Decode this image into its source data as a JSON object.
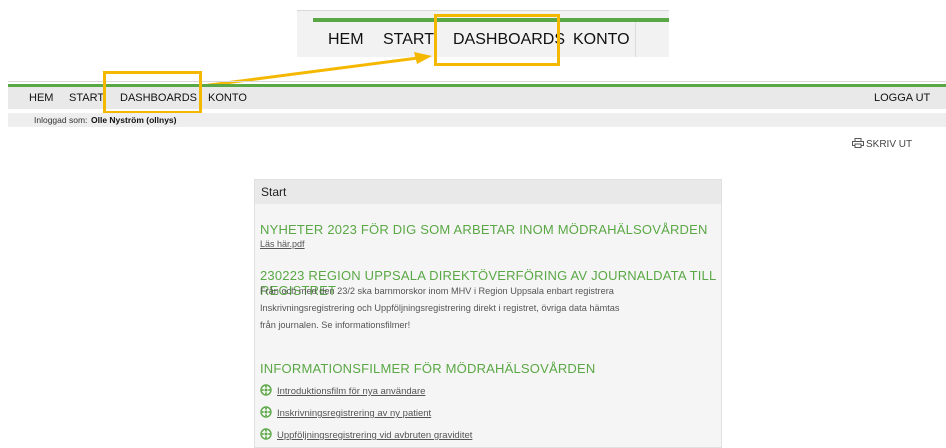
{
  "zoomed_nav": {
    "items": [
      "HEM",
      "START",
      "DASHBOARDS",
      "KONTO"
    ]
  },
  "main_nav": {
    "items": [
      "HEM",
      "START",
      "DASHBOARDS",
      "KONTO"
    ],
    "logout": "LOGGA UT"
  },
  "login": {
    "prefix": "Inloggad som:",
    "user": "Olle Nyström (ollnys)"
  },
  "print_label": "SKRIV UT",
  "panel": {
    "title": "Start",
    "news_heading": "NYHETER 2023 FÖR DIG SOM ARBETAR INOM MÖDRAHÄLSOVÅRDEN",
    "news_link": "Läs här.pdf",
    "region_heading": "230223 REGION UPPSALA DIREKTÖVERFÖRING AV JOURNALDATA TILL REGISTRET",
    "region_text_lines": [
      "Från och med den 23/2 ska barnmorskor inom MHV i Region Uppsala enbart registrera",
      "Inskrivningsregistrering och Uppföljningsregistrering direkt i registret, övriga data hämtas",
      "från journalen. Se informationsfilmer!"
    ],
    "films_heading": "INFORMATIONSFILMER FÖR MÖDRAHÄLSOVÅRDEN",
    "films": [
      "Introduktionsfilm för nya användare",
      "Inskrivningsregistrering av ny patient",
      "Uppföljningsregistrering vid avbruten graviditet"
    ]
  },
  "colors": {
    "accent_green": "#5aa845",
    "highlight_yellow": "#f5b800"
  }
}
